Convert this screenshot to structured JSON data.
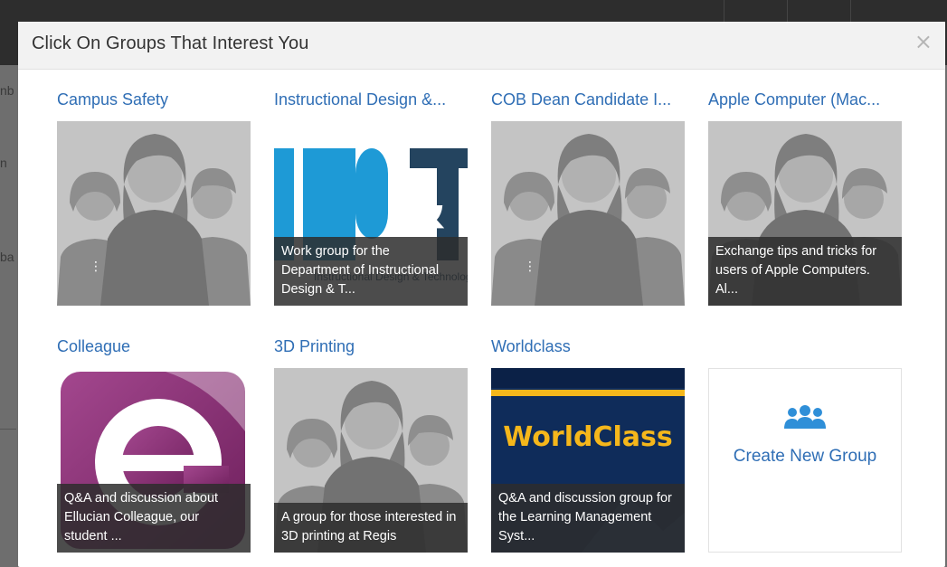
{
  "modal": {
    "title": "Click On Groups That Interest You",
    "close_glyph": "×"
  },
  "background": {
    "fragments": [
      "nb",
      "n",
      "ba"
    ]
  },
  "groups": [
    {
      "title": "Campus Safety",
      "image": "default-group-avatar",
      "description": ""
    },
    {
      "title": "Instructional Design &...",
      "image": "idt-logo",
      "logo_text": "ID&T",
      "logo_sub": "Instructional Design & Technology",
      "description": "Work group for the Department of Instructional Design & T..."
    },
    {
      "title": "COB Dean Candidate I...",
      "image": "default-group-avatar",
      "description": ""
    },
    {
      "title": "Apple Computer (Mac...",
      "image": "default-group-avatar",
      "description": "Exchange tips and tricks for users of Apple Computers. Al..."
    },
    {
      "title": "Colleague",
      "image": "colleague-logo",
      "logo_text": "e",
      "description": "Q&A and discussion about Ellucian Colleague, our student ..."
    },
    {
      "title": "3D Printing",
      "image": "default-group-avatar",
      "description": "A group for those interested in 3D printing at Regis"
    },
    {
      "title": "Worldclass",
      "image": "worldclass-logo",
      "logo_text": "WorldClass",
      "description": "Q&A and discussion group for the Learning Management Syst..."
    }
  ],
  "create_group": {
    "label": "Create New Group",
    "icon": "users-group-icon"
  },
  "colors": {
    "link_blue": "#2f6eb5",
    "overlay": "#2d2d2d",
    "idt_blue": "#1e9ad6",
    "idt_navy": "#24445f",
    "worldclass_navy": "#0f2c5a",
    "worldclass_gold": "#f5b71b",
    "colleague_purple": "#8b2d74"
  }
}
